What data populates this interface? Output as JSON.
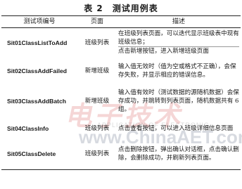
{
  "caption": "表 2　测试用例表",
  "headers": {
    "id": "测试项编号",
    "page": "页面",
    "desc": "描述"
  },
  "rows": [
    {
      "id": "Sit01ClassListToAdd",
      "page": "班级列表",
      "desc": [
        "在班级列表页面，可以迭代显示班级表中现有班级信息；",
        "点击新增按钮，进入新增班级页面"
      ]
    },
    {
      "id": "Sit02ClassAddFailed",
      "page": "新增班级",
      "desc": [
        "输入值无效时（值为空或格式不正确），会保存失败，并显示相应的错误信息。"
      ]
    },
    {
      "id": "Sit03ClassAddBatch",
      "page": "新增班级",
      "desc": [
        "输入值有效时（测试数据的源随机数据）会保存成功，并跳转到列表页面，随机数据共有 6 组。"
      ]
    },
    {
      "id": "Sit04ClassInfo",
      "page": "班级列表",
      "desc": [
        "点击查看按钮，可以进入班级详细信息页面"
      ]
    },
    {
      "id": "Sit05ClassDelete",
      "page": "班级列表",
      "desc": [
        "点击删除按钮，弹出确认对话框，点击确认删除，会删除成功，并刷新列表页面。"
      ]
    }
  ],
  "watermark": {
    "logo": "电子技术",
    "sub": "APPLICATION OF ELECTRONIC",
    "site": "www.ChinaAET.com"
  }
}
